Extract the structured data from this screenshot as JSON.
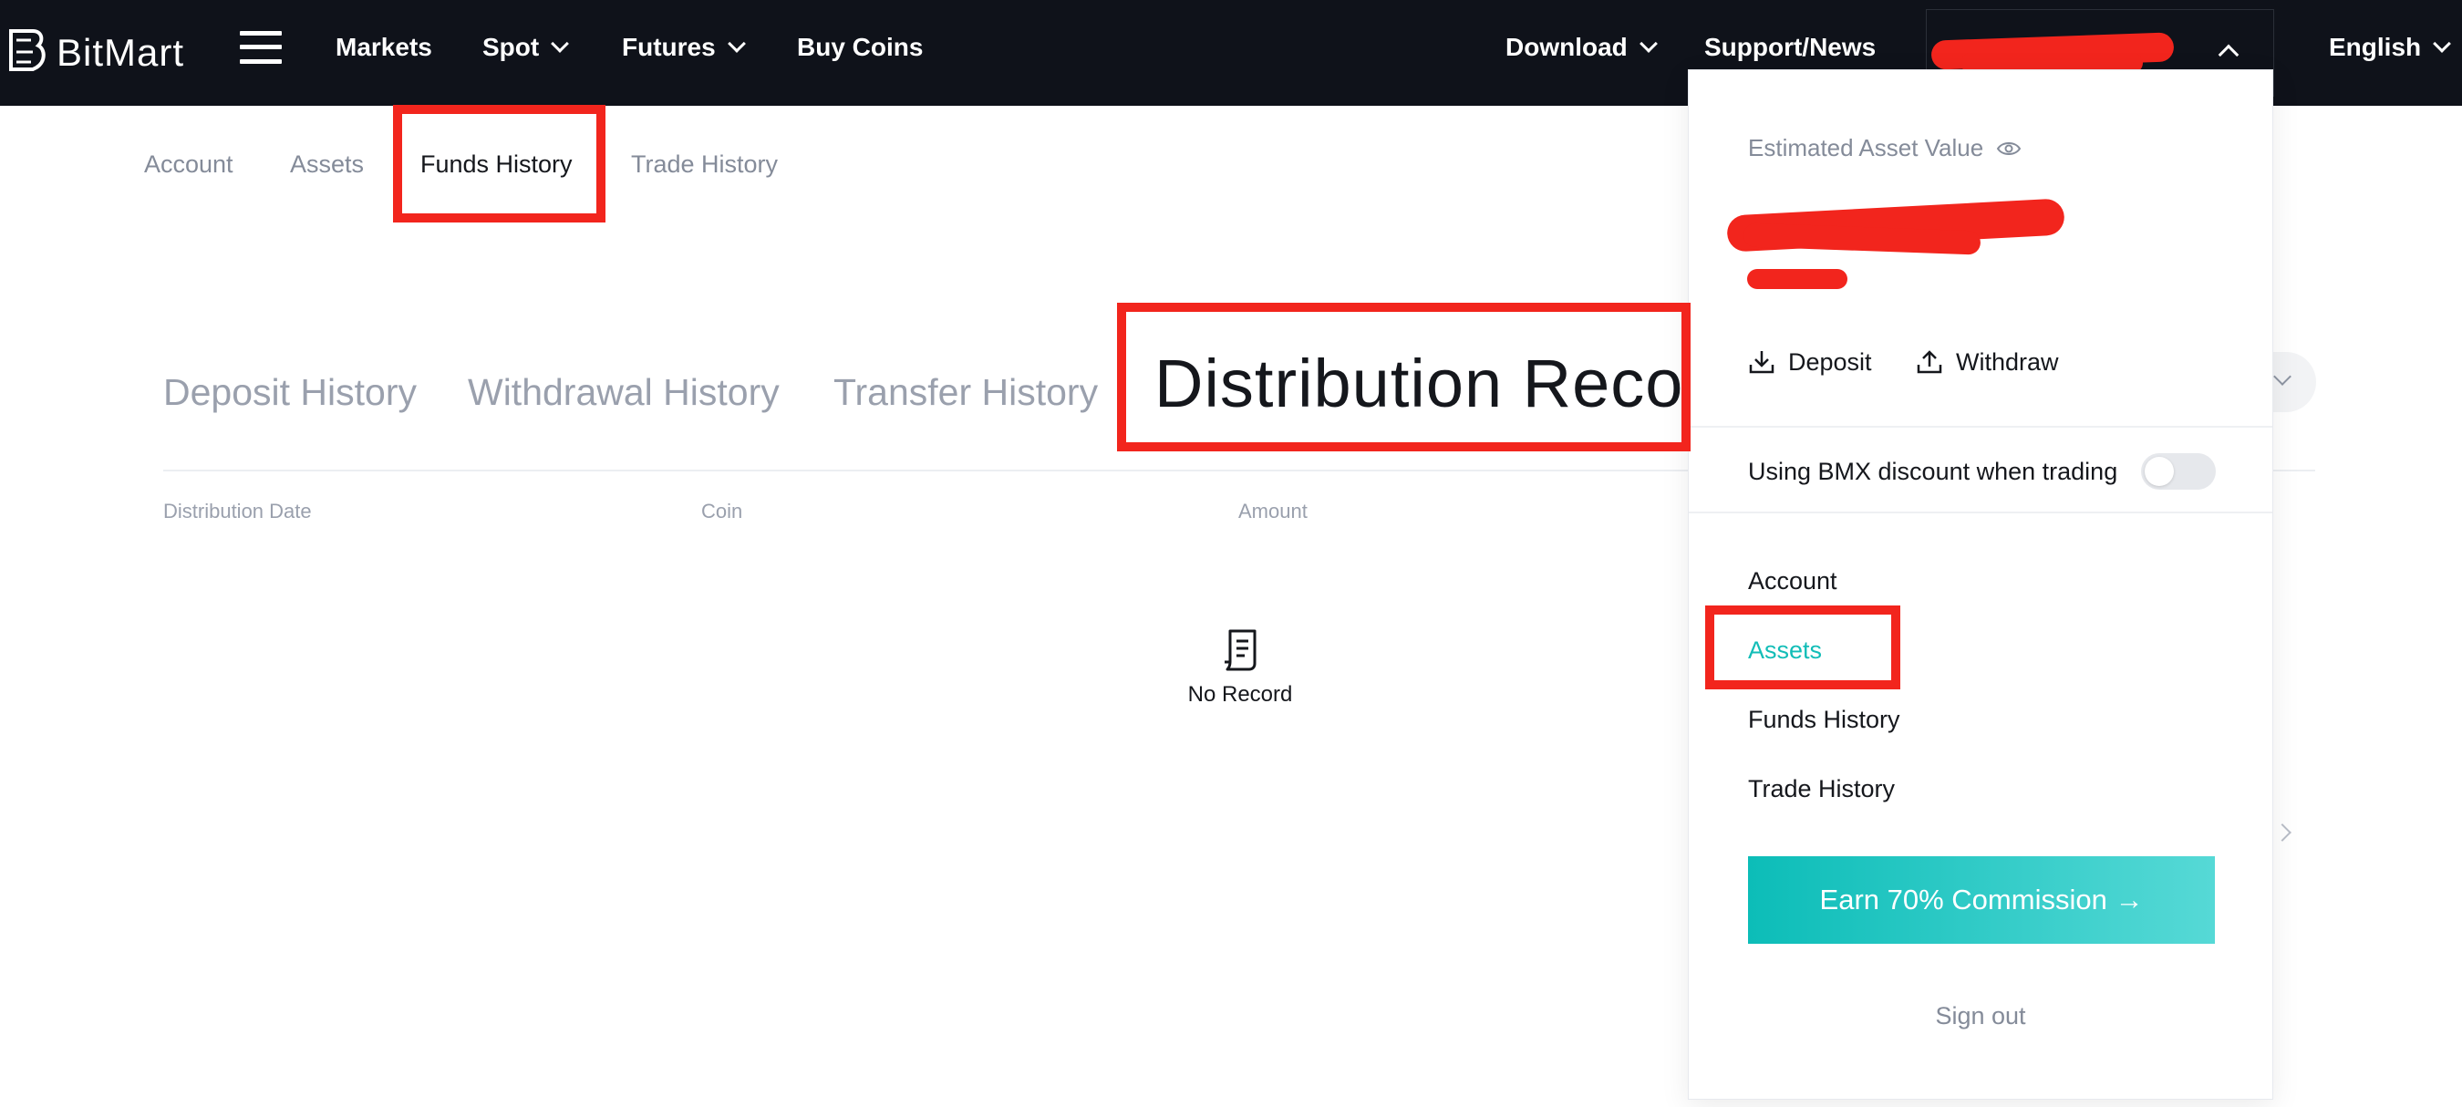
{
  "brand": {
    "name": "BitMart"
  },
  "topnav": {
    "items": [
      {
        "label": "Markets",
        "has_caret": false
      },
      {
        "label": "Spot",
        "has_caret": true
      },
      {
        "label": "Futures",
        "has_caret": true
      },
      {
        "label": "Buy Coins",
        "has_caret": false
      }
    ],
    "right_items": [
      {
        "label": "Download",
        "has_caret": true
      },
      {
        "label": "Support/News",
        "has_caret": false
      }
    ],
    "language": "English"
  },
  "subnav": {
    "items": [
      "Account",
      "Assets",
      "Funds History",
      "Trade History"
    ],
    "active": "Funds History"
  },
  "history_tabs": {
    "items": [
      "Deposit History",
      "Withdrawal History",
      "Transfer History",
      "Distribution Reco"
    ],
    "active": "Distribution Reco"
  },
  "table": {
    "columns": [
      "Distribution Date",
      "Coin",
      "Amount"
    ],
    "empty_text": "No Record"
  },
  "dropdown": {
    "estimated_label": "Estimated Asset Value",
    "deposit": "Deposit",
    "withdraw": "Withdraw",
    "bmx_discount": "Using BMX discount when trading",
    "bmx_discount_on": false,
    "links": [
      "Account",
      "Assets",
      "Funds History",
      "Trade History"
    ],
    "active_link": "Assets",
    "earn_button": "Earn 70% Commission →",
    "sign_out": "Sign out"
  },
  "colors": {
    "nav_bg": "#0f121a",
    "accent": "#12bdb7",
    "highlight": "#f2251d",
    "muted_text": "#848b99"
  },
  "icons": [
    "menu-icon",
    "chevron-down-icon",
    "chevron-up-icon",
    "eye-icon",
    "download-icon",
    "upload-icon",
    "document-icon",
    "chevron-right-icon"
  ]
}
